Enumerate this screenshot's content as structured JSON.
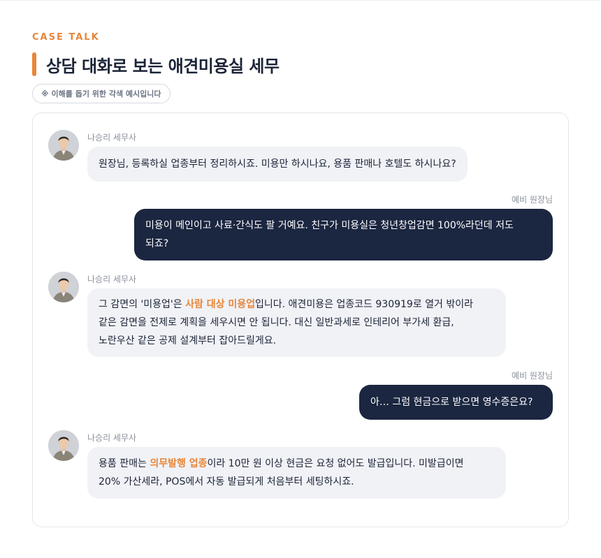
{
  "header": {
    "eyebrow": "CASE TALK",
    "title": "상담 대화로 보는 애견미용실 세무",
    "note": "※ 이해를 돕기 위한 각색 예시입니다"
  },
  "colors": {
    "accent": "#e8863a",
    "navy": "#1b2640",
    "bubble_gray": "#f1f2f6"
  },
  "conversation": {
    "messages": [
      {
        "speaker": "나승리 세무사",
        "side": "left",
        "text": "원장님, 등록하실 업종부터 정리하시죠. 미용만 하시나요, 용품 판매나 호텔도 하시나요?"
      },
      {
        "speaker": "예비 원장님",
        "side": "right",
        "line1": "미용이 메인이고 사료·간식도 팔 거예요. 친구가 미용실은 청년창업감면 100%라던데 저도",
        "line2": "되죠?"
      },
      {
        "speaker": "나승리 세무사",
        "side": "left",
        "line1_pre": "그 감면의 '미용업'은 ",
        "line1_hl": "사람 대상 미용업",
        "line1_post": "입니다. 애견미용은 업종코드 930919로 열거 밖이라",
        "line2": "같은 감면을 전제로 계획을 세우시면 안 됩니다. 대신 일반과세로 인테리어 부가세 환급,",
        "line3": "노란우산 같은 공제 설계부터 잡아드릴게요."
      },
      {
        "speaker": "예비 원장님",
        "side": "right",
        "text": "아… 그럼 현금으로 받으면 영수증은요?"
      },
      {
        "speaker": "나승리 세무사",
        "side": "left",
        "line1_pre": "용품 판매는 ",
        "line1_hl": "의무발행 업종",
        "line1_post": "이라 10만 원 이상 현금은 요청 없어도 발급입니다. 미발급이면",
        "line2": "20% 가산세라, POS에서 자동 발급되게 처음부터 세팅하시죠."
      }
    ]
  }
}
